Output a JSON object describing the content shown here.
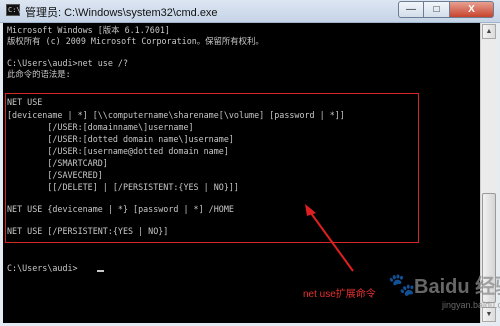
{
  "window": {
    "title": "管理员: C:\\Windows\\system32\\cmd.exe",
    "icon_label": "C:\\",
    "controls": {
      "minimize": "—",
      "maximize": "□",
      "close": "X"
    }
  },
  "console": {
    "lines": [
      "Microsoft Windows [版本 6.1.7601]",
      "版权所有 (c) 2009 Microsoft Corporation。保留所有权利。",
      "",
      "C:\\Users\\audi>net use /?",
      "此命令的语法是:",
      "",
      "NET USE",
      "[devicename | *] [\\\\computername\\sharename[\\volume] [password | *]]",
      "        [/USER:[domainname\\]username]",
      "        [/USER:[dotted domain name\\]username]",
      "        [/USER:[username@dotted domain name]",
      "        [/SMARTCARD]",
      "        [/SAVECRED]",
      "        [[/DELETE] | [/PERSISTENT:{YES | NO}]]",
      "",
      "NET USE {devicename | *} [password | *] /HOME",
      "",
      "NET USE [/PERSISTENT:{YES | NO}]",
      "",
      "",
      "C:\\Users\\audi>"
    ]
  },
  "annotation": {
    "label": "net use扩展命令",
    "color": "#e83030"
  },
  "scrollbar": {
    "up_arrow": "▲",
    "down_arrow": "▼"
  },
  "watermark": {
    "brand": "Baidu 经验",
    "sub": "jingyan.baidu.com"
  }
}
